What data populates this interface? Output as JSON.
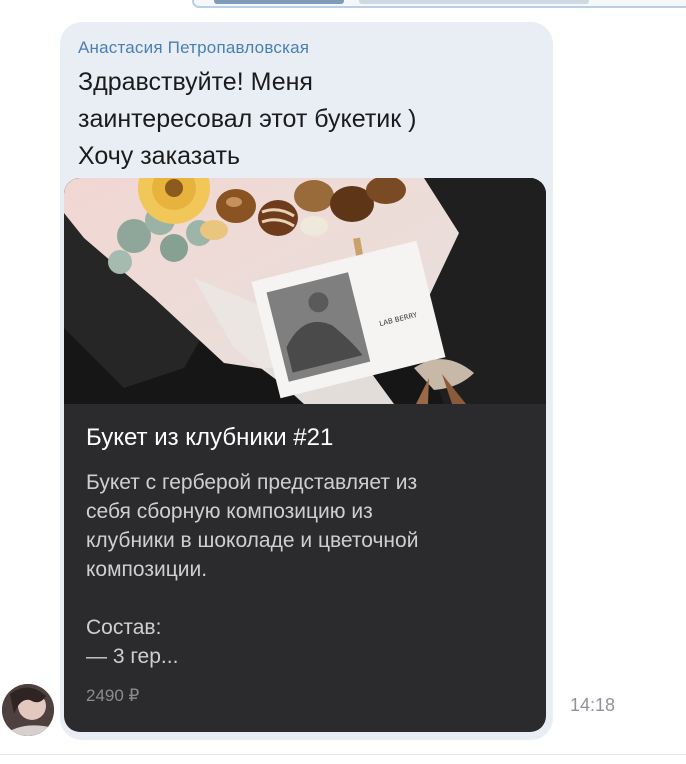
{
  "message": {
    "sender": "Анастасия Петропавловская",
    "text_lines": [
      "Здравствуйте! Меня",
      "заинтересовал этот букетик )",
      "Хочу заказать"
    ],
    "time": "14:18"
  },
  "product": {
    "title": "Букет из клубники #21",
    "description_lines": [
      "Букет с герберой представляет из",
      "себя сборную композицию из",
      "клубники в шоколаде и цветочной",
      "композиции."
    ],
    "composition_label": "Состав:",
    "composition_preview": "— 3 гер...",
    "price": "2490 ₽",
    "photo_brand": "LAB BERRY"
  },
  "colors": {
    "bubble": "#e9eef5",
    "sender": "#4a7fb4",
    "card": "#2b2b2d"
  }
}
